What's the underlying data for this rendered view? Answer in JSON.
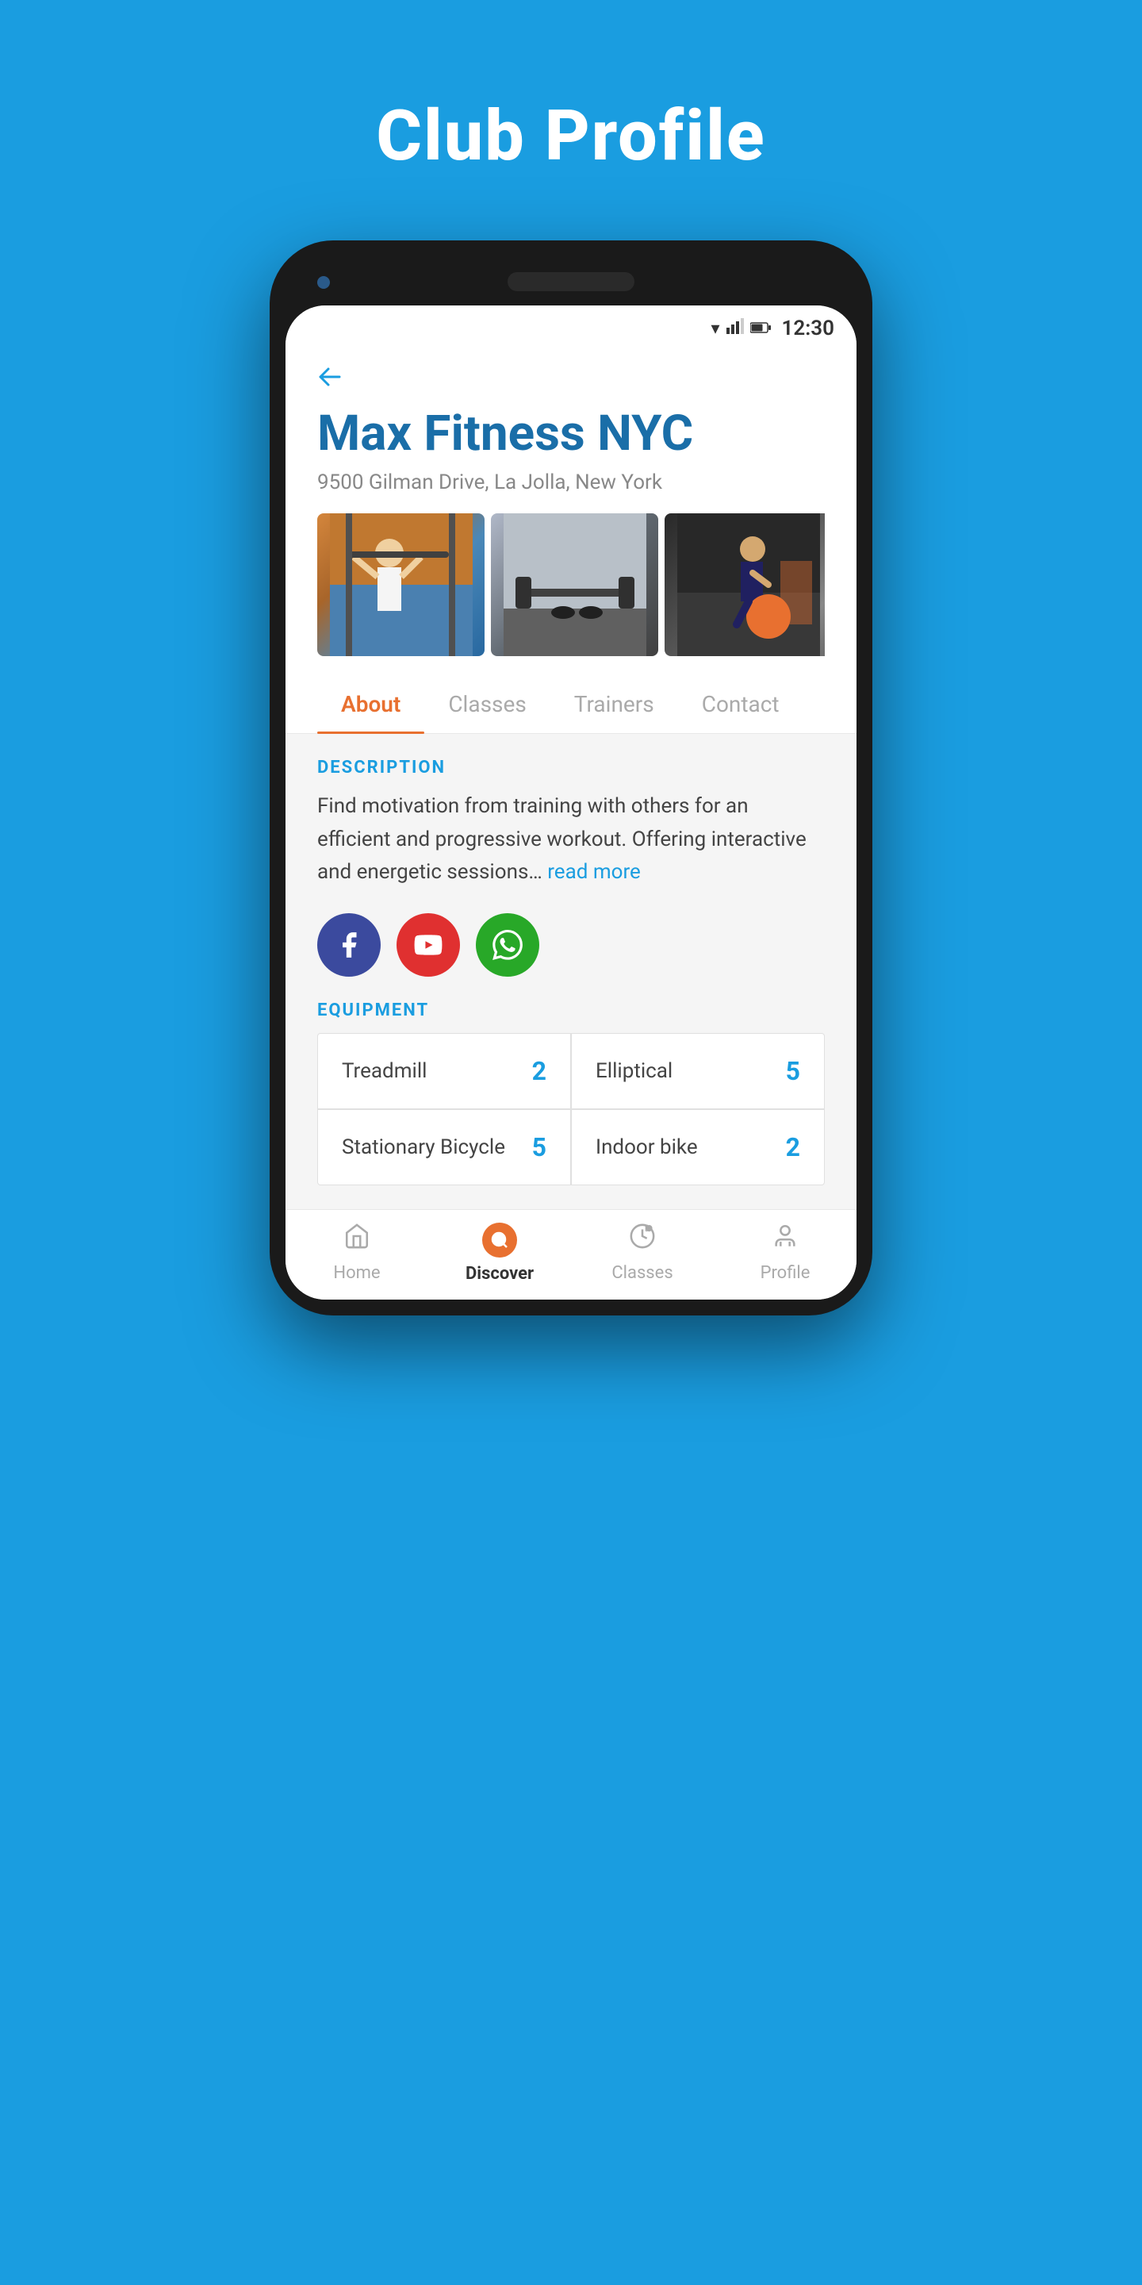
{
  "page": {
    "title": "Club Profile",
    "background_color": "#1a9de0"
  },
  "status_bar": {
    "time": "12:30"
  },
  "club": {
    "name": "Max Fitness NYC",
    "address": "9500 Gilman Drive, La Jolla, New York"
  },
  "tabs": [
    {
      "id": "about",
      "label": "About",
      "active": true
    },
    {
      "id": "classes",
      "label": "Classes",
      "active": false
    },
    {
      "id": "trainers",
      "label": "Trainers",
      "active": false
    },
    {
      "id": "contact",
      "label": "Contact",
      "active": false
    }
  ],
  "about": {
    "description_label": "DESCRIPTION",
    "description": "Find motivation from training with others for an efficient and progressive workout. Offering interactive and energetic sessions…",
    "read_more": "read more",
    "equipment_label": "EQUIPMENT",
    "equipment": [
      {
        "name": "Treadmill",
        "count": "2"
      },
      {
        "name": "Elliptical",
        "count": "5"
      },
      {
        "name": "Stationary Bicycle",
        "count": "5"
      },
      {
        "name": "Indoor bike",
        "count": "2"
      }
    ]
  },
  "social": [
    {
      "name": "facebook",
      "type": "facebook"
    },
    {
      "name": "youtube",
      "type": "youtube"
    },
    {
      "name": "whatsapp",
      "type": "whatsapp"
    }
  ],
  "bottom_nav": [
    {
      "id": "home",
      "label": "Home",
      "active": false
    },
    {
      "id": "discover",
      "label": "Discover",
      "active": true
    },
    {
      "id": "classes",
      "label": "Classes",
      "active": false
    },
    {
      "id": "profile",
      "label": "Profile",
      "active": false
    }
  ]
}
